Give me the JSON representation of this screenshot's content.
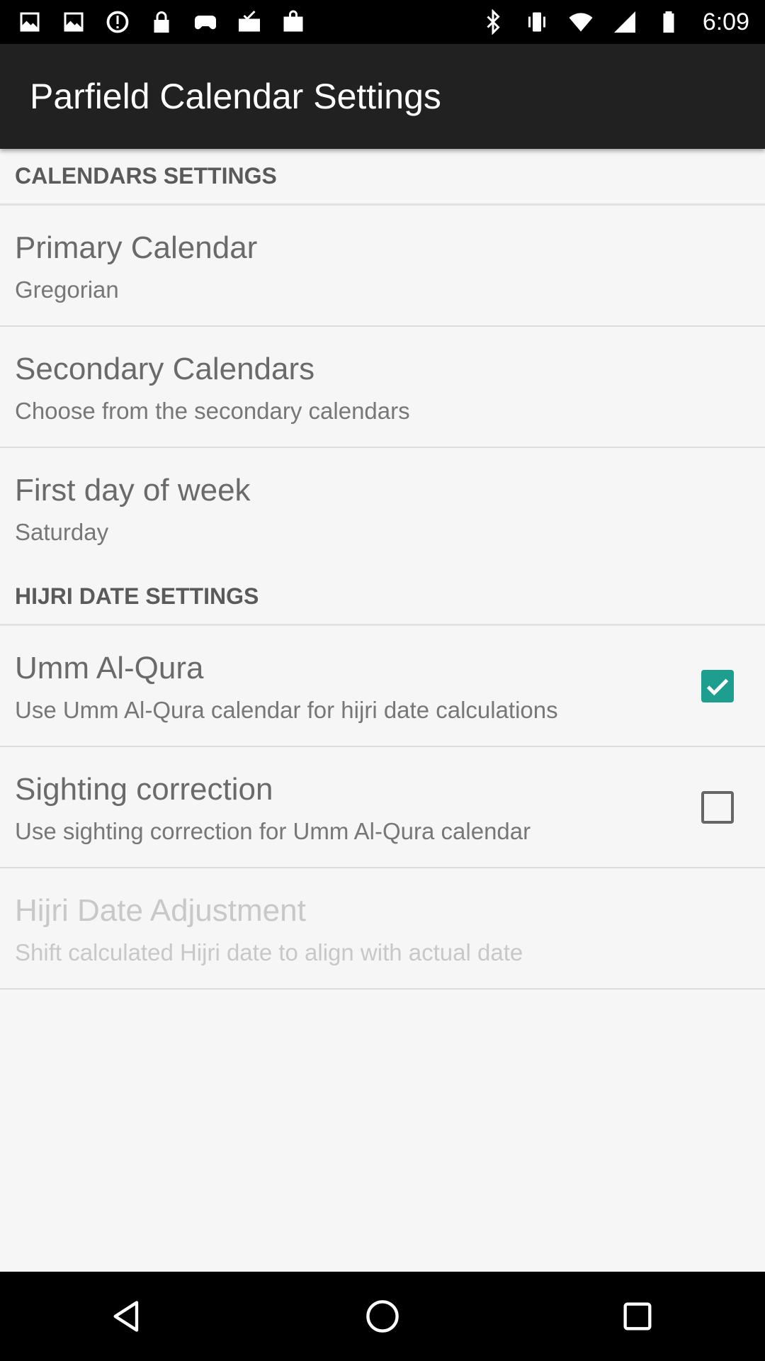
{
  "status_bar": {
    "time": "6:09",
    "left_icons": [
      "image-icon",
      "image-icon",
      "alert-icon",
      "lock-icon",
      "game-controller-icon",
      "mail-check-icon",
      "shopping-bag-icon"
    ],
    "right_icons": [
      "bluetooth-icon",
      "vibrate-icon",
      "wifi-icon",
      "signal-icon",
      "battery-icon"
    ]
  },
  "app_bar": {
    "title": "Parfield Calendar Settings"
  },
  "sections": {
    "calendars": {
      "header": "CALENDARS SETTINGS",
      "primary": {
        "title": "Primary Calendar",
        "summary": "Gregorian"
      },
      "secondary": {
        "title": "Secondary Calendars",
        "summary": "Choose from the secondary calendars"
      },
      "first_day": {
        "title": "First day of week",
        "summary": "Saturday"
      }
    },
    "hijri": {
      "header": "HIJRI DATE SETTINGS",
      "umm_al_qura": {
        "title": "Umm Al-Qura",
        "summary": "Use Umm Al-Qura calendar for hijri date calculations",
        "checked": true
      },
      "sighting": {
        "title": "Sighting correction",
        "summary": "Use sighting correction for Umm Al-Qura calendar",
        "checked": false
      },
      "adjustment": {
        "title": "Hijri Date Adjustment",
        "summary": "Shift calculated Hijri date to align with actual date",
        "enabled": false
      }
    }
  },
  "colors": {
    "accent": "#1e9e8e",
    "app_bar": "#212121",
    "background": "#f6f6f6"
  },
  "nav_bar": {
    "icons": [
      "back-icon",
      "home-icon",
      "recents-icon"
    ]
  }
}
